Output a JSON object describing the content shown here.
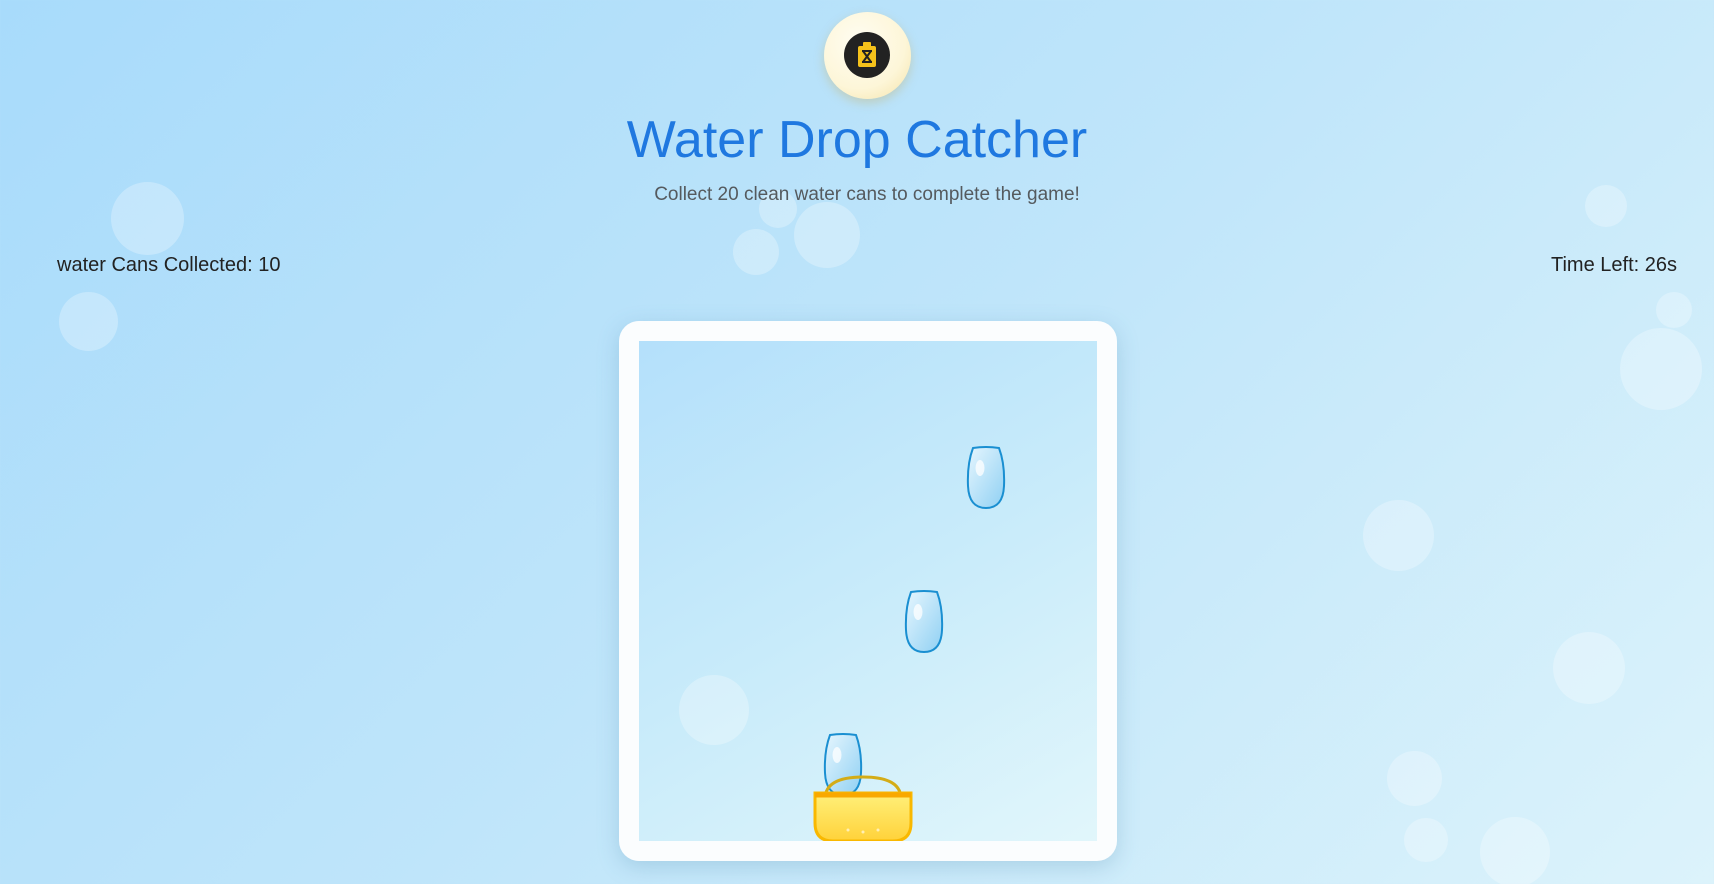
{
  "header": {
    "logo_icon": "water-can-icon",
    "title": "Water Drop Catcher",
    "subtitle": "Collect 20 clean water cans to complete the game!"
  },
  "stats": {
    "collected_label": "water Cans Collected: 10",
    "time_label": "Time Left: 26s"
  },
  "game": {
    "collected": 10,
    "goal": 20,
    "time_left_seconds": 26,
    "drop_count": 3
  },
  "colors": {
    "title": "#1f78e0",
    "drop_stroke": "#1a8fd1",
    "basket": "#f9c21a"
  }
}
